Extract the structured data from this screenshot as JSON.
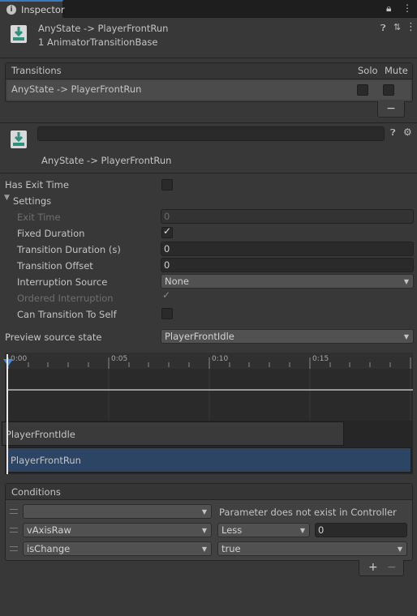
{
  "tab": {
    "label": "Inspector",
    "lock_icon": "lock-icon",
    "menu_icon": "more-vert-icon"
  },
  "header": {
    "title": "AnyState -> PlayerFrontRun",
    "subtitle": "1 AnimatorTransitionBase"
  },
  "transitions": {
    "header": "Transitions",
    "solo_label": "Solo",
    "mute_label": "Mute",
    "rows": [
      {
        "name": "AnyState -> PlayerFrontRun",
        "solo": false,
        "mute": false
      }
    ],
    "remove_label": "−"
  },
  "transition": {
    "name_value": "",
    "title": "AnyState -> PlayerFrontRun"
  },
  "props": {
    "has_exit_time": {
      "label": "Has Exit Time",
      "value": false
    },
    "settings_label": "Settings",
    "exit_time": {
      "label": "Exit Time",
      "value": "0"
    },
    "fixed_duration": {
      "label": "Fixed Duration",
      "value": true
    },
    "transition_duration": {
      "label": "Transition Duration (s)",
      "value": "0"
    },
    "transition_offset": {
      "label": "Transition Offset",
      "value": "0"
    },
    "interruption_source": {
      "label": "Interruption Source",
      "value": "None"
    },
    "ordered_interruption": {
      "label": "Ordered Interruption",
      "value": true
    },
    "can_transition_to_self": {
      "label": "Can Transition To Self",
      "value": false
    },
    "preview_source_state": {
      "label": "Preview source state",
      "value": "PlayerFrontIdle"
    }
  },
  "timeline": {
    "ticks": [
      "0:00",
      "0:05",
      "0:10",
      "0:15"
    ],
    "source_state": "PlayerFrontIdle",
    "dest_state": "PlayerFrontRun"
  },
  "conditions": {
    "header": "Conditions",
    "rows": [
      {
        "param": "",
        "mode": "",
        "value": "",
        "message": "Parameter does not exist in Controller"
      },
      {
        "param": "vAxisRaw",
        "mode": "Less",
        "value": "0",
        "message": ""
      },
      {
        "param": "isChange",
        "mode": "true",
        "value": "",
        "message": ""
      }
    ],
    "add_label": "+",
    "remove_label": "−"
  },
  "colors": {
    "accent": "#3a79bb",
    "panel": "#383838",
    "selection": "#2d4565"
  }
}
